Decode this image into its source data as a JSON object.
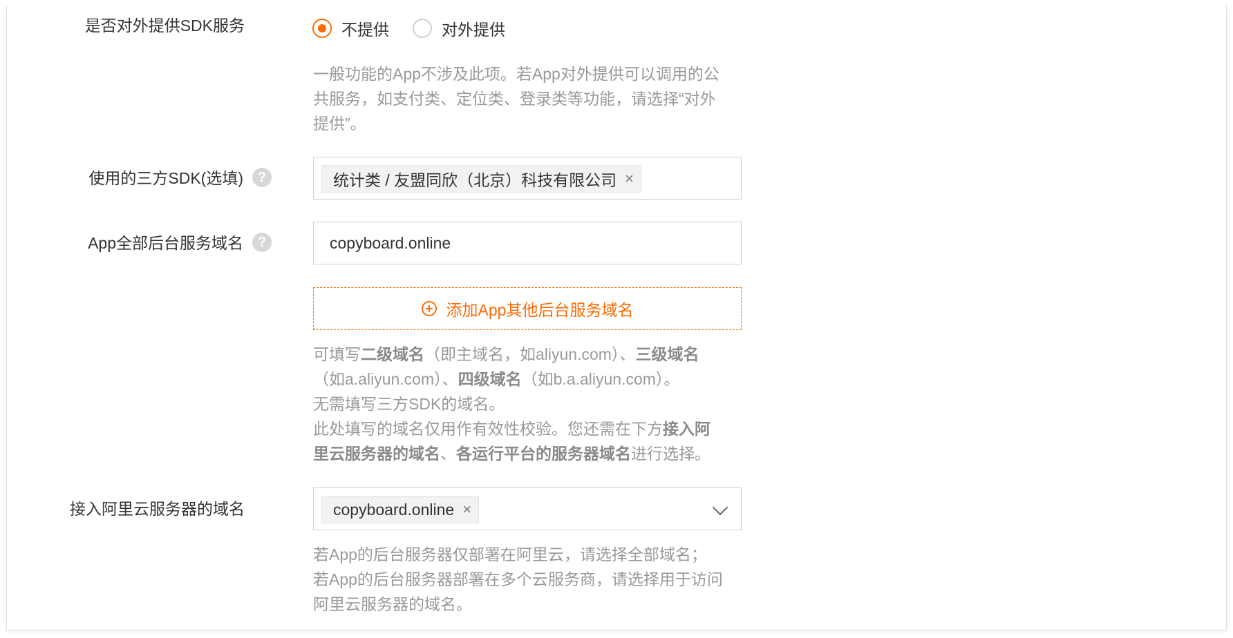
{
  "sdk_service": {
    "label": "是否对外提供SDK服务",
    "options": [
      {
        "label": "不提供",
        "checked": true
      },
      {
        "label": "对外提供",
        "checked": false
      }
    ],
    "help_lines": [
      "一般功能的App不涉及此项。若App对外提供可以调用的公",
      "共服务，如支付类、定位类、登录类等功能，请选择“对外",
      "提供”。"
    ]
  },
  "third_party_sdk": {
    "label": "使用的三方SDK(选填)",
    "help_icon": "?",
    "tags": [
      {
        "text": "统计类 / 友盟同欣（北京）科技有限公司",
        "close": "×"
      }
    ]
  },
  "domain": {
    "label": "App全部后台服务域名",
    "help_icon": "?",
    "value": "copyboard.online",
    "add_button": "添加App其他后台服务域名",
    "help": {
      "l1_a": "可填写",
      "l1_b": "二级域名",
      "l1_c": "（即主域名，如aliyun.com）、",
      "l1_d": "三级域名",
      "l2_a": "（如a.aliyun.com）、",
      "l2_b": "四级域名",
      "l2_c": "（如b.a.aliyun.com）。",
      "l3": "无需填写三方SDK的域名。",
      "l4_a": "此处填写的域名仅用作有效性校验。您还需在下方",
      "l4_b": "接入阿",
      "l5_a": "里云服务器的域名",
      "l5_b": "、",
      "l5_c": "各运行平台的服务器域名",
      "l5_d": "进行选择。"
    }
  },
  "aliyun_domain": {
    "label": "接入阿里云服务器的域名",
    "tags": [
      {
        "text": "copyboard.online",
        "close": "×"
      }
    ],
    "help_lines": [
      "若App的后台服务器仅部署在阿里云，请选择全部域名；",
      "若App的后台服务器部署在多个云服务商，请选择用于访问",
      "阿里云服务器的域名。"
    ]
  },
  "colors": {
    "accent": "#ff6a00",
    "help_text": "#999999",
    "label": "#333333"
  }
}
